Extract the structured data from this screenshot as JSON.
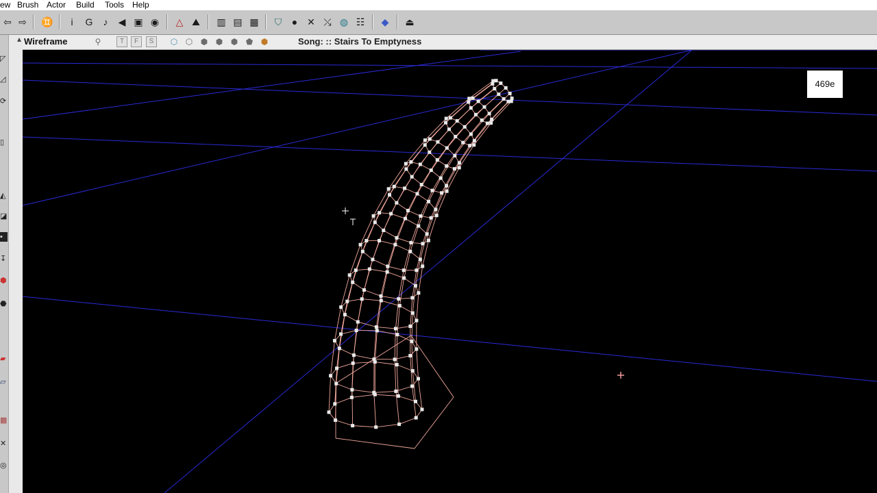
{
  "menu": [
    "ew",
    "Brush",
    "Actor",
    "Build",
    "Tools",
    "Help"
  ],
  "toolbar": {
    "icons": [
      "back-arrow-icon",
      "forward-arrow-icon",
      "binoculars-icon",
      "info-icon",
      "g-icon",
      "actor-icon",
      "sound-icon",
      "texture-icon",
      "eye-icon",
      "mesh-icon",
      "terrain-icon",
      "build-geometry-icon",
      "build-lighting-icon",
      "build-paths-icon",
      "shield-icon",
      "light-bulb-icon",
      "compass-icon",
      "path-icon",
      "globe-icon",
      "settings-icon",
      "cube-icon",
      "play-icon"
    ]
  },
  "viewport": {
    "mode_label": "Wireframe",
    "filter_buttons": [
      "T",
      "F",
      "S"
    ],
    "song_label": "Song: :: Stairs To Emptyness",
    "badge_text": "469e"
  },
  "colors": {
    "grid_line": "#2a2ad8",
    "brush_wire": "#f2a89c",
    "vertex": "#e8e8e8",
    "background": "#000000"
  }
}
